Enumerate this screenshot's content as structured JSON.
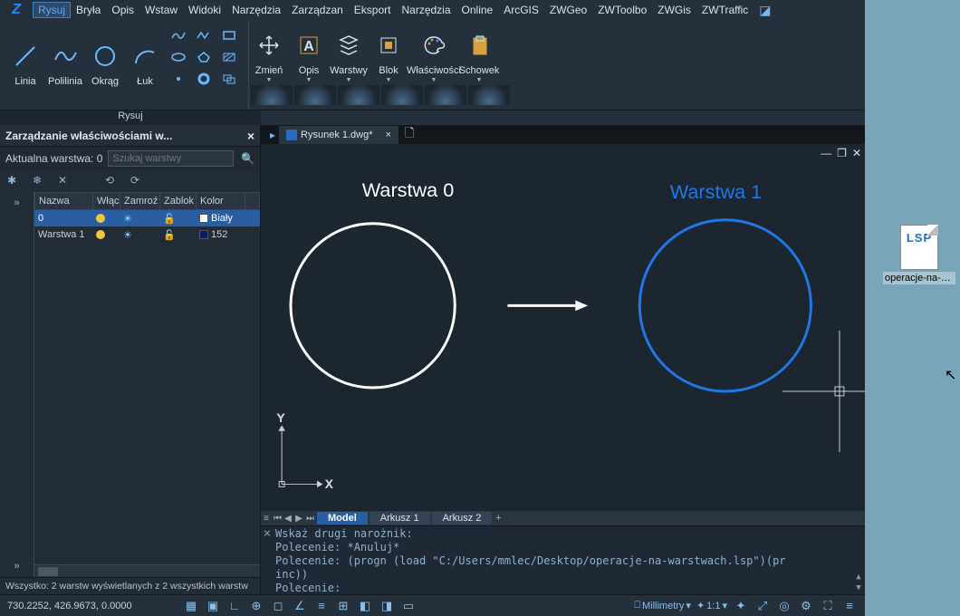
{
  "menu": {
    "items": [
      "Rysuj",
      "Bryła",
      "Opis",
      "Wstaw",
      "Widoki",
      "Narzędzia",
      "Zarządzan",
      "Eksport",
      "Narzędzia",
      "Online",
      "ArcGIS",
      "ZWGeo",
      "ZWToolbo",
      "ZWGis",
      "ZWTraffic"
    ],
    "active_index": 0
  },
  "ribbon": {
    "group1_title": "Rysuj",
    "big": [
      "Linia",
      "Polilinia",
      "Okrąg",
      "Łuk"
    ],
    "right_big": [
      "Zmień",
      "Opis",
      "Warstwy",
      "Blok",
      "Właściwości",
      "Schowek"
    ]
  },
  "panel": {
    "title": "Zarządzanie właściwościami w...",
    "current_layer_label": "Aktualna warstwa: 0",
    "search_placeholder": "Szukaj warstwy",
    "cols": {
      "name": "Nazwa",
      "on": "Włąc",
      "freeze": "Zamroź",
      "lock": "Zablok",
      "color": "Kolor"
    },
    "rows": [
      {
        "name": "0",
        "color_label": "Biały",
        "color": "#ffffff",
        "selected": true
      },
      {
        "name": "Warstwa 1",
        "color_label": "152",
        "color": "#0a1e66",
        "selected": false
      }
    ],
    "status": "Wszystko: 2 warstw wyświetlanych z 2 wszystkich warstw"
  },
  "doc": {
    "tab_name": "Rysunek 1.dwg*",
    "canvas": {
      "label_left": "Warstwa 0",
      "label_right": "Warstwa 1",
      "axis_x": "X",
      "axis_y": "Y"
    },
    "sheet_tabs": [
      "Model",
      "Arkusz 1",
      "Arkusz 2"
    ]
  },
  "console": {
    "lines": [
      "Wskaż drugi narożnik:",
      "Polecenie: *Anuluj*",
      "Polecenie: (progn (load \"C:/Users/mmlec/Desktop/operacje-na-warstwach.lsp\")(pr",
      "inc))",
      "Polecenie:"
    ]
  },
  "status": {
    "coords": "730.2252, 426.9673, 0.0000",
    "units_label": "Millimetry",
    "scale_label": "1:1"
  },
  "desktop": {
    "file_badge": "LSP",
    "file_label": "operacje-na-warst..."
  }
}
